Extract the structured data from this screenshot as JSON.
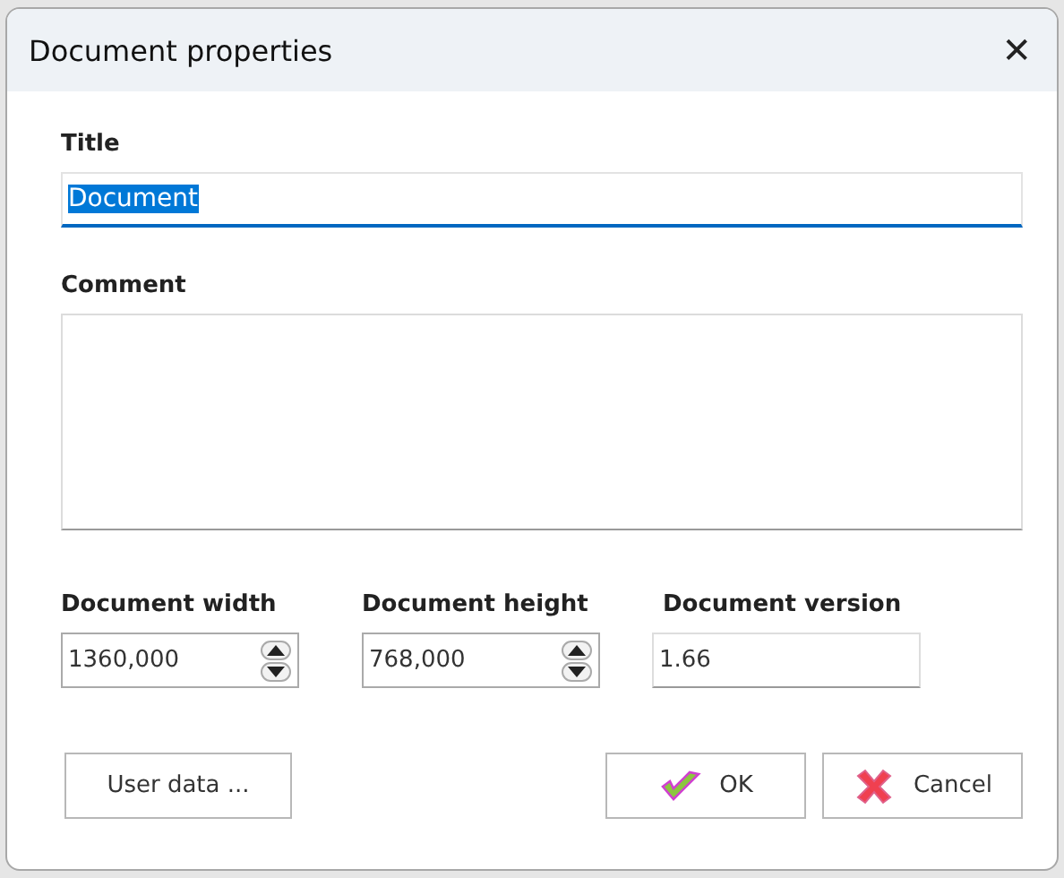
{
  "window": {
    "title": "Document properties",
    "close": "✕"
  },
  "title_field": {
    "label": "Title",
    "value": "Document",
    "focused": true,
    "text_selected": true
  },
  "comment_field": {
    "label": "Comment"
  },
  "fields": [
    {
      "label": "Document width",
      "value": "1360,000",
      "kind": "spinner"
    },
    {
      "label": "Document height",
      "value": "768,000",
      "kind": "spinner"
    },
    {
      "label": "Document version",
      "value": "1.66",
      "kind": "text"
    }
  ],
  "buttons": [
    {
      "label": "User data ...",
      "kind": "plain"
    },
    {
      "label": "OK",
      "kind": "ok"
    },
    {
      "label": "Cancel",
      "kind": "cancel"
    }
  ]
}
